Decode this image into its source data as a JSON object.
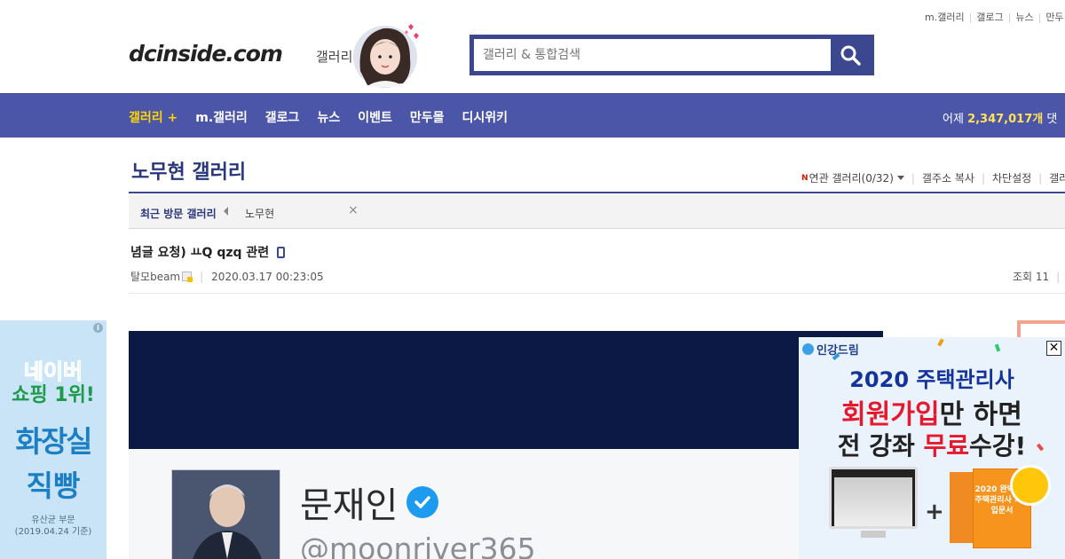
{
  "top_links": [
    "m.갤러리",
    "갤로그",
    "뉴스",
    "만두"
  ],
  "header": {
    "logo": "dcinside.com",
    "logo_sub": "갤러리",
    "search_placeholder": "갤러리 & 통합검색"
  },
  "nav": {
    "items": [
      "갤러리 +",
      "m.갤러리",
      "갤로그",
      "뉴스",
      "이벤트",
      "만두몰",
      "디시위키"
    ],
    "right_prefix": "어제",
    "right_number": "2,347,017개",
    "right_suffix": "댓"
  },
  "gallery": {
    "title": "노무현 갤러리",
    "tools": {
      "new_mark": "N",
      "related": "연관 갤러리(0/32)",
      "copy": "갤주소 복사",
      "block": "차단설정",
      "cut": "갤러"
    }
  },
  "recent": {
    "label": "최근 방문 갤러리",
    "items": [
      "노무현"
    ],
    "close": "×"
  },
  "post": {
    "title": "념글 요청) ㅛQ qzq 관련",
    "writer": "탈모beam",
    "date": "2020.03.17 00:23:05",
    "views": "조회 11"
  },
  "left_ad": {
    "info": "i",
    "line1": "네이버",
    "line2": "쇼핑 1위!",
    "line3": "화장실",
    "line4": "직빵",
    "foot1": "유산균 부문",
    "foot2": "(2019.04.24 기준)"
  },
  "content_image": {
    "name": "문재인",
    "handle": "@moonriver365"
  },
  "right_ad": {
    "brand": "인강드림",
    "close": "✕",
    "line1": "2020 주택관리사",
    "line2_red": "회원가입",
    "line2_rest": "만 하면",
    "line3_a": "전 강좌 ",
    "line3_red": "무료",
    "line3_b": "수강!",
    "plus": "+",
    "book_text": "2020 완벽대비 주택관리사 기초입문서"
  },
  "colors": {
    "brand_blue": "#3b4890",
    "nav_bg": "#4b56a8",
    "nav_highlight": "#ffd400",
    "title_blue": "#29367c"
  }
}
